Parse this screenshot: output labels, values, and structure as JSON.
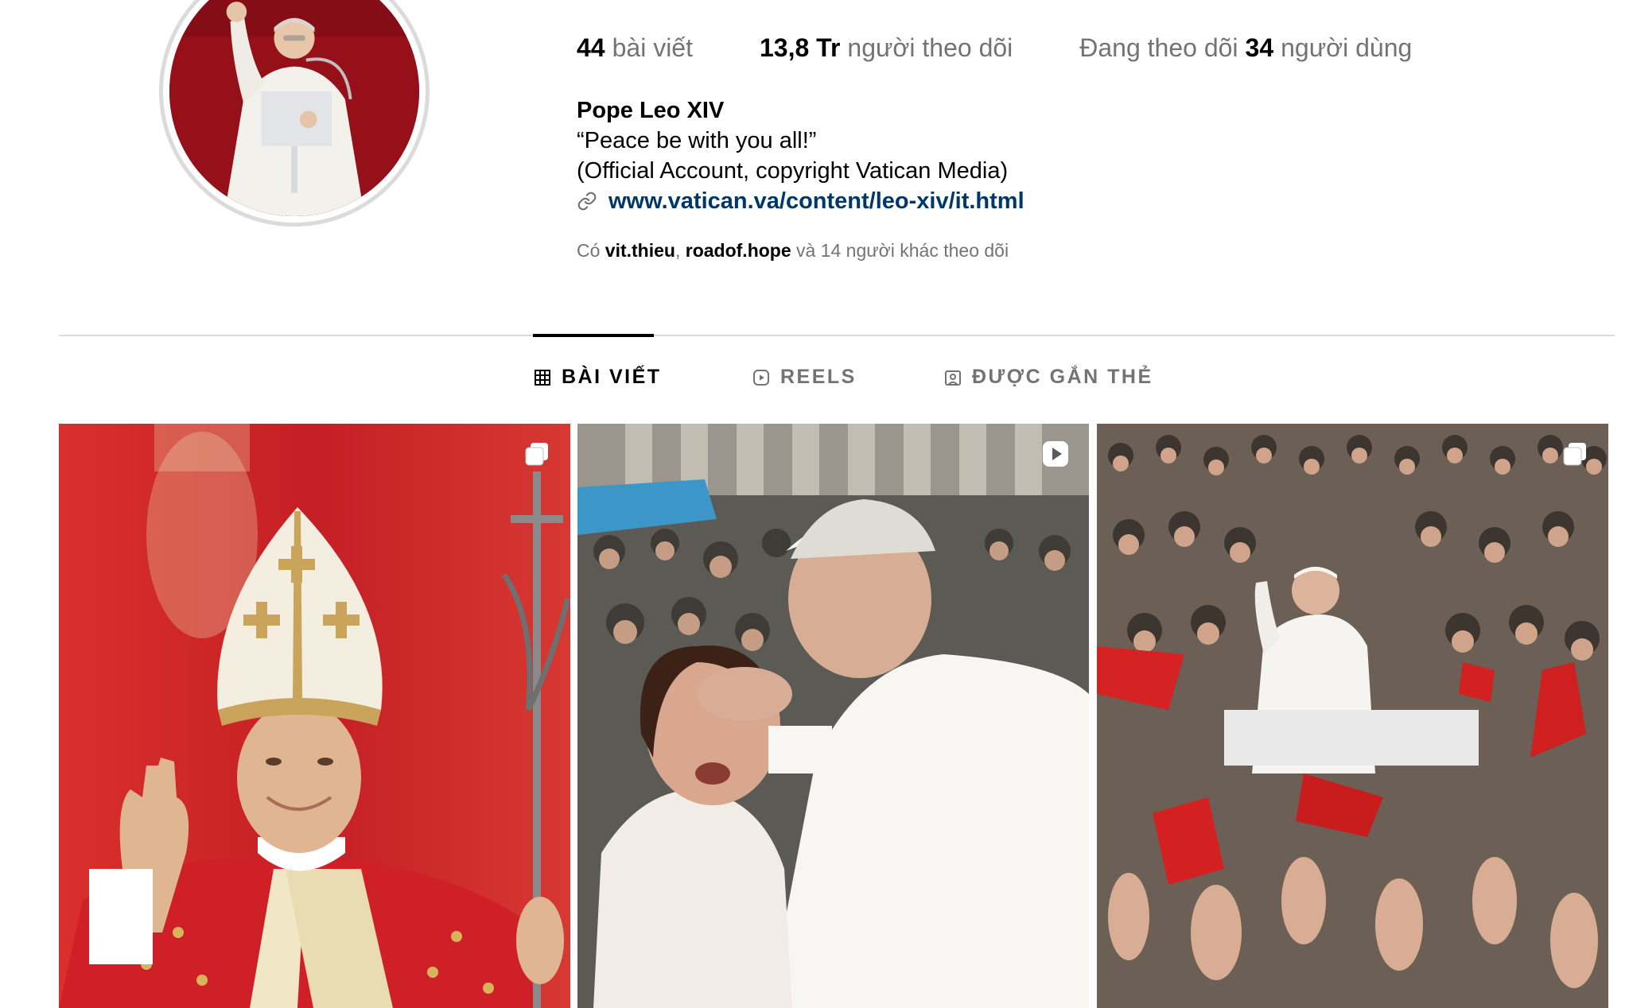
{
  "profile": {
    "stats": {
      "posts_count": "44",
      "posts_label": "bài viết",
      "followers_count": "13,8 Tr",
      "followers_label": "người theo dõi",
      "following_prefix": "Đang theo dõi",
      "following_count": "34",
      "following_label": "người dùng"
    },
    "bio": {
      "name": "Pope Leo XIV",
      "line1": "“Peace be with you all!”",
      "line2": "(Official Account, copyright Vatican Media)",
      "link": "www.vatican.va/content/leo-xiv/it.html",
      "link_icon": "link-icon"
    },
    "followed_by": {
      "prefix": "Có",
      "user1": "vit.thieu",
      "separator": ",",
      "user2": "roadof.hope",
      "suffix": "và 14 người khác theo dõi"
    }
  },
  "tabs": [
    {
      "label": "BÀI VIẾT",
      "icon": "grid-icon",
      "active": true
    },
    {
      "label": "REELS",
      "icon": "reels-icon",
      "active": false
    },
    {
      "label": "ĐƯỢC GẮN THẺ",
      "icon": "tagged-icon",
      "active": false
    }
  ],
  "posts": [
    {
      "badge": "carousel-icon"
    },
    {
      "badge": "reel-play-icon"
    },
    {
      "badge": "carousel-icon"
    }
  ],
  "colors": {
    "link": "#00376b",
    "muted": "#737373",
    "divider": "#dbdbdb",
    "avatar_bg": "#8e0d17"
  }
}
